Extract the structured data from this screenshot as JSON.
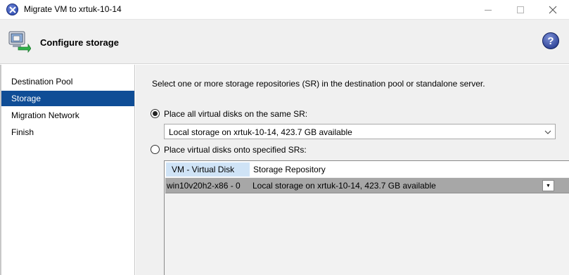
{
  "window": {
    "title": "Migrate VM to xrtuk-10-14",
    "close_glyph": "×",
    "minimize_label": "",
    "maximize_label": ""
  },
  "header": {
    "title": "Configure storage",
    "help_glyph": "?"
  },
  "nav": {
    "items": [
      {
        "label": "Destination Pool",
        "active": false
      },
      {
        "label": "Storage",
        "active": true
      },
      {
        "label": "Migration Network",
        "active": false
      },
      {
        "label": "Finish",
        "active": false
      }
    ]
  },
  "content": {
    "description": "Select one or more storage repositories (SR) in the destination pool or standalone server.",
    "option_same_sr": {
      "label": "Place all virtual disks on the same SR:",
      "checked": true
    },
    "same_sr_combo": {
      "value": "Local storage on xrtuk-10-14, 423.7 GB available",
      "arrow": "⌄"
    },
    "option_specified_sr": {
      "label": "Place virtual disks onto specified SRs:",
      "checked": false
    },
    "grid": {
      "columns": [
        "VM - Virtual Disk",
        "Storage Repository"
      ],
      "rows": [
        {
          "disk": "win10v20h2-x86 - 0",
          "repository": "Local storage on xrtuk-10-14, 423.7 GB available",
          "dropdown": "▼"
        }
      ]
    }
  },
  "colors": {
    "nav_active_bg": "#0f4d96",
    "header_bg": "#f0f0f0",
    "selected_row_bg": "#a7a7a7",
    "column_header_highlight": "#cfe3f6"
  },
  "icons": {
    "app": "close-circle-icon",
    "header": "vm-migrate-icon",
    "help": "help-icon"
  }
}
